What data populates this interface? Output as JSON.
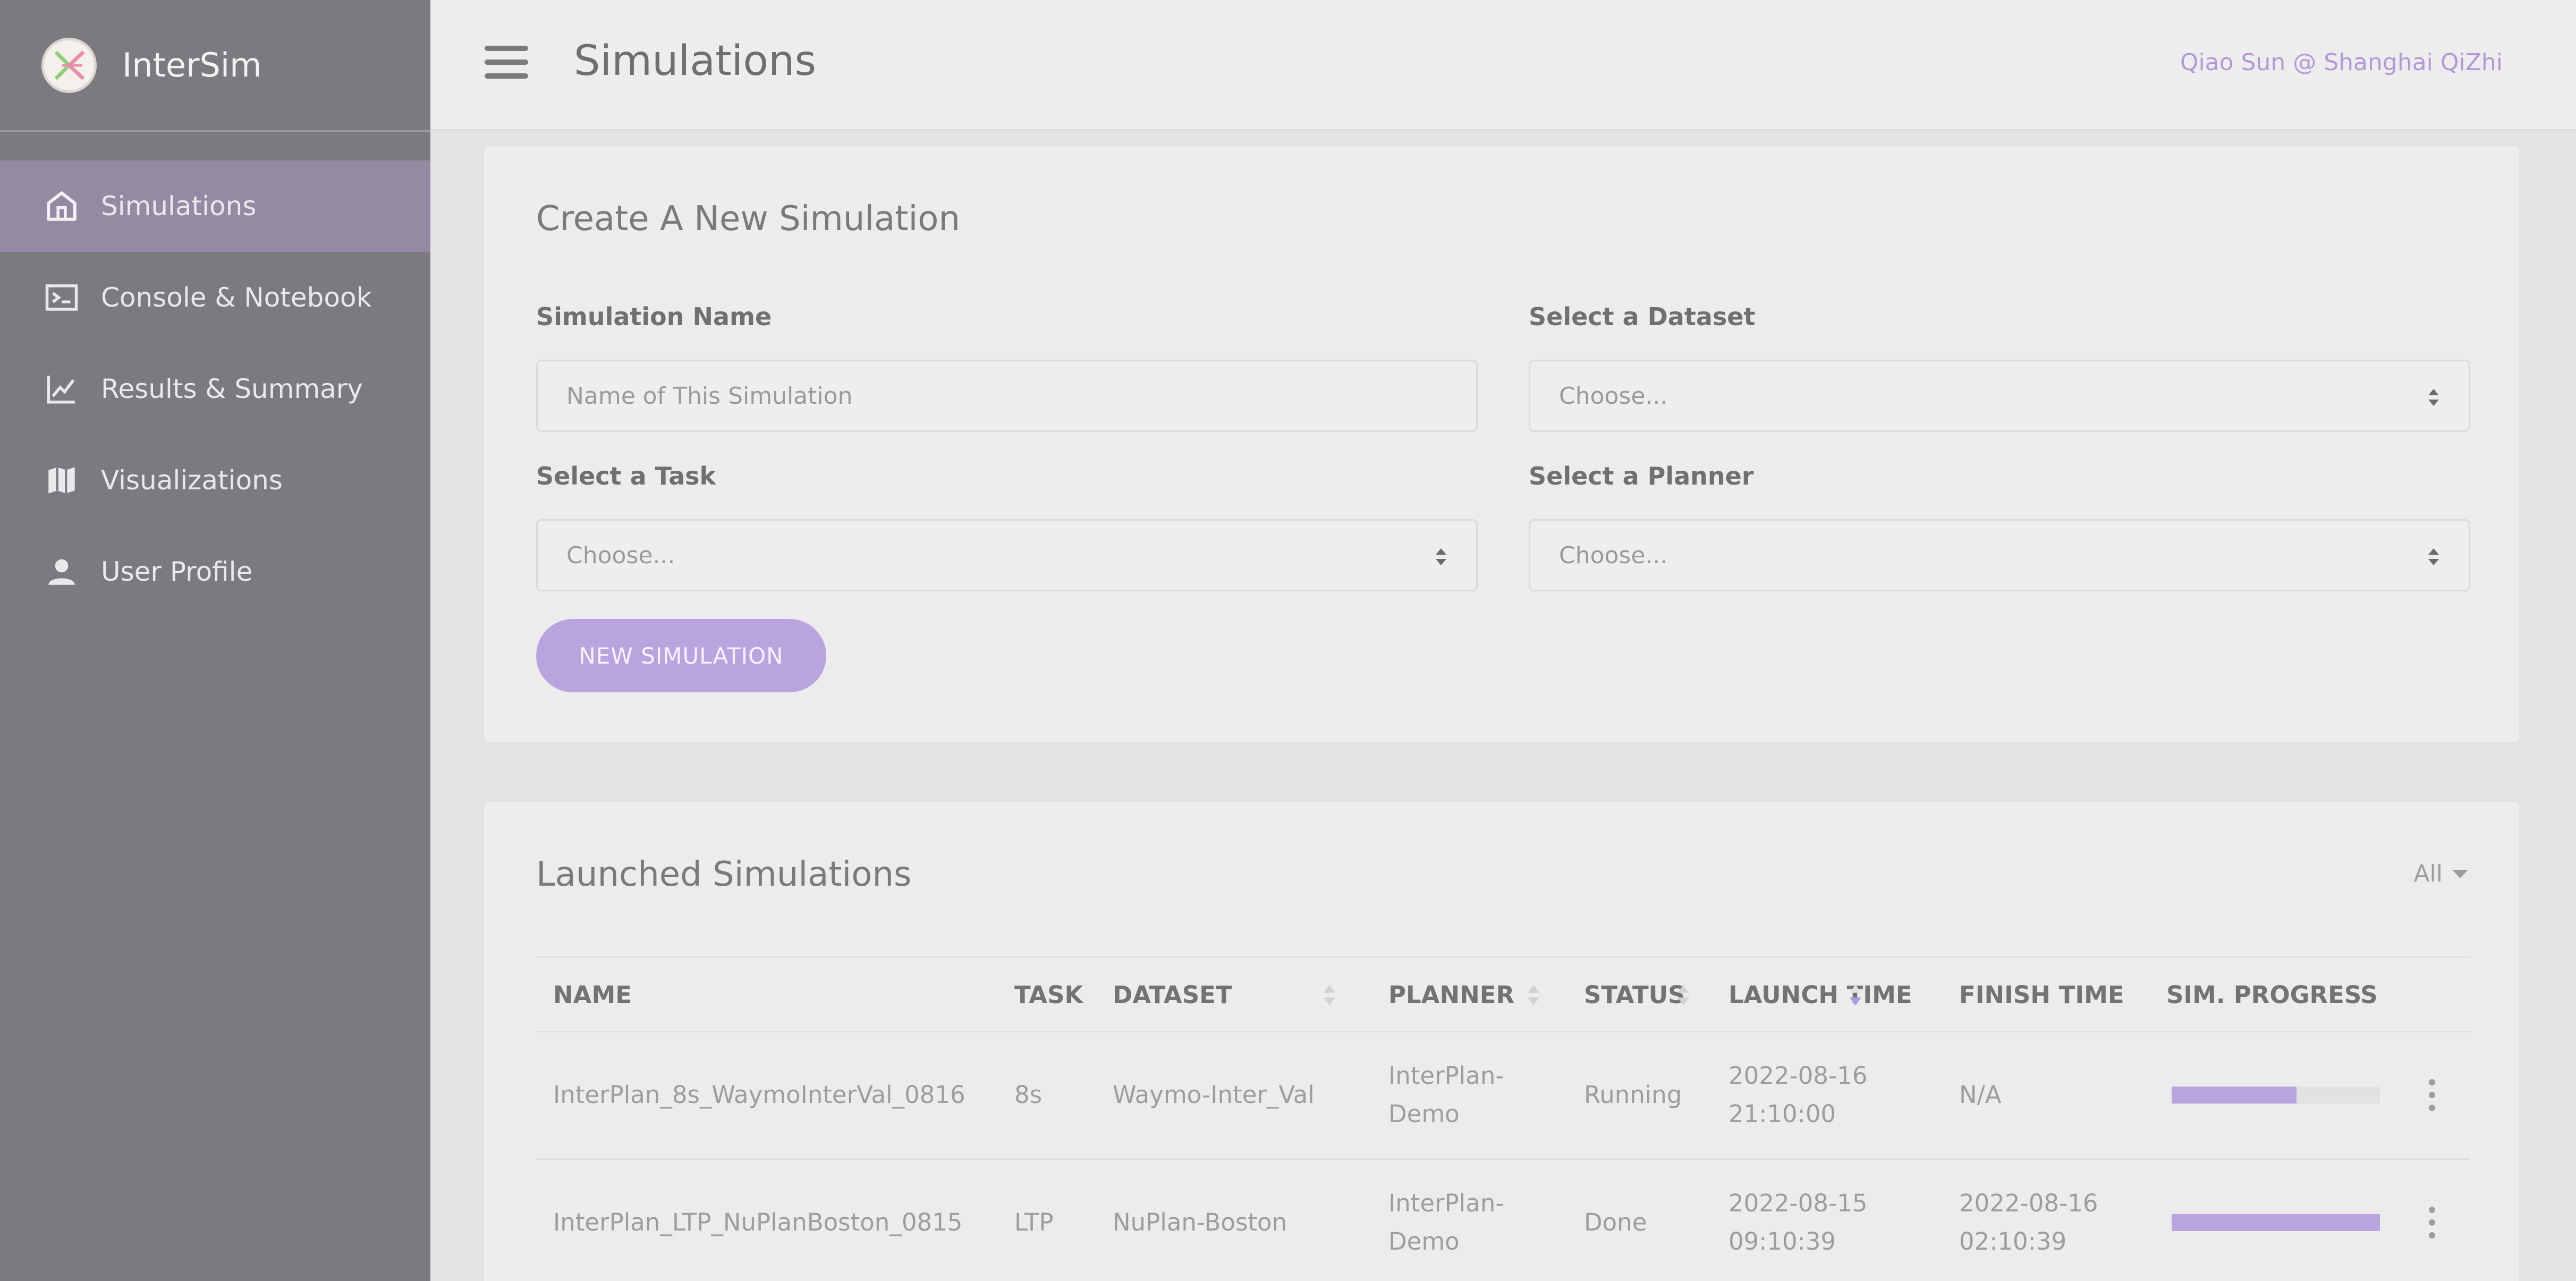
{
  "app": {
    "name": "InterSim"
  },
  "sidebar": {
    "items": [
      {
        "label": "Simulations",
        "icon": "home-icon",
        "active": true
      },
      {
        "label": "Console & Notebook",
        "icon": "terminal-icon",
        "active": false
      },
      {
        "label": "Results & Summary",
        "icon": "line-chart-icon",
        "active": false
      },
      {
        "label": "Visualizations",
        "icon": "map-icon",
        "active": false
      },
      {
        "label": "User Profile",
        "icon": "user-icon",
        "active": false
      }
    ]
  },
  "header": {
    "title": "Simulations",
    "user": "Qiao Sun @ Shanghai QiZhi"
  },
  "create": {
    "title": "Create A New Simulation",
    "name_label": "Simulation Name",
    "name_placeholder": "Name of This Simulation",
    "dataset_label": "Select a Dataset",
    "dataset_value": "Choose...",
    "task_label": "Select a Task",
    "task_value": "Choose...",
    "planner_label": "Select a Planner",
    "planner_value": "Choose...",
    "button": "NEW SIMULATION"
  },
  "launched": {
    "title": "Launched Simulations",
    "filter": "All",
    "columns": [
      "NAME",
      "TASK",
      "DATASET",
      "PLANNER",
      "STATUS",
      "LAUNCH TIME",
      "FINISH TIME",
      "SIM. PROGRESS"
    ],
    "rows": [
      {
        "name": "InterPlan_8s_WaymoInterVal_0816",
        "task": "8s",
        "dataset": "Waymo-Inter_Val",
        "planner": [
          "InterPlan-",
          "Demo"
        ],
        "status": "Running",
        "launch": [
          "2022-08-16",
          "21:10:00"
        ],
        "finish": [
          "N/A",
          ""
        ],
        "progress": 0.6
      },
      {
        "name": "InterPlan_LTP_NuPlanBoston_0815",
        "task": "LTP",
        "dataset": "NuPlan-Boston",
        "planner": [
          "InterPlan-",
          "Demo"
        ],
        "status": "Done",
        "launch": [
          "2022-08-15",
          "09:10:39"
        ],
        "finish": [
          "2022-08-16",
          "02:10:39"
        ],
        "progress": 1.0
      }
    ]
  },
  "colors": {
    "accent": "#b9a4df",
    "sidebar": "#7a7a7f",
    "sidebar_active": "#958aa4"
  }
}
